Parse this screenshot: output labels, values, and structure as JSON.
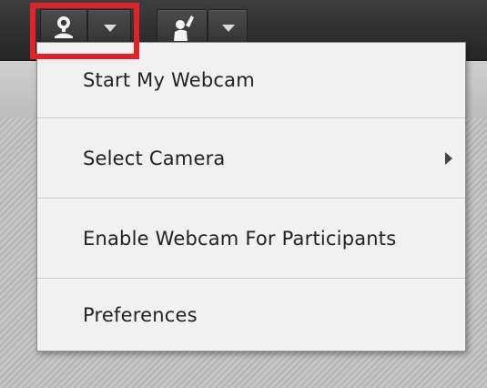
{
  "toolbar": {
    "buttons": [
      {
        "icon": "webcam-icon"
      },
      {
        "icon": "dropdown-arrow-icon"
      },
      {
        "icon": "raise-hand-icon"
      },
      {
        "icon": "dropdown-arrow-icon"
      }
    ],
    "highlight_color": "#e1222b"
  },
  "menu": {
    "items": [
      {
        "label": "Start My Webcam"
      },
      {
        "label": "Select Camera",
        "submenu": true
      },
      {
        "label": "Enable Webcam For Participants"
      },
      {
        "label": "Preferences"
      }
    ]
  }
}
